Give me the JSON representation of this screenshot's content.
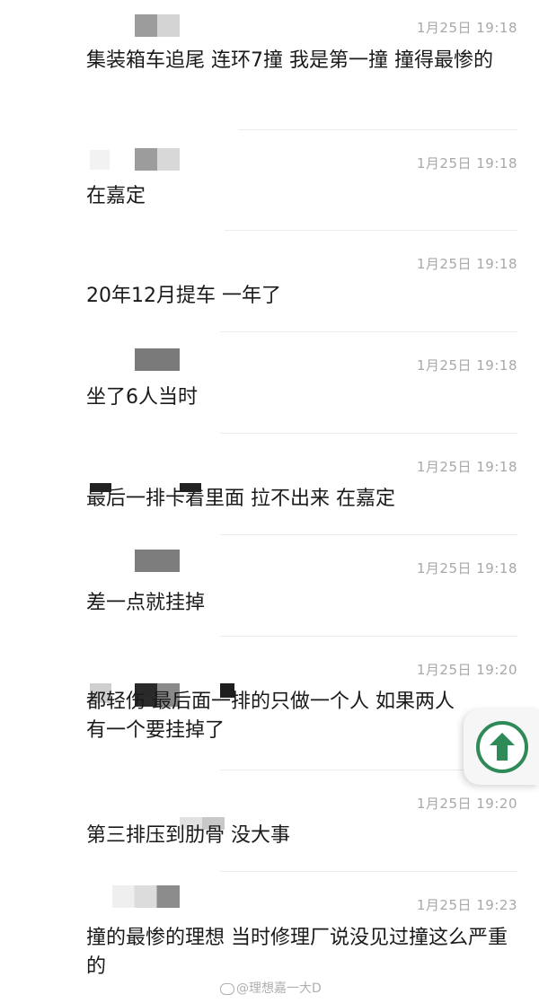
{
  "comments": [
    {
      "time": "1月25日 19:18",
      "text": "集装箱车追尾 连环7撞 我是第一撞 撞得最惨的"
    },
    {
      "time": "1月25日 19:18",
      "text": "在嘉定"
    },
    {
      "time": "1月25日 19:18",
      "text": "20年12月提车 一年了"
    },
    {
      "time": "1月25日 19:18",
      "text": "坐了6人当时"
    },
    {
      "time": "1月25日 19:18",
      "text": "最后一排卡着里面 拉不出来 在嘉定"
    },
    {
      "time": "1月25日 19:18",
      "text": "差一点就挂掉"
    },
    {
      "time": "1月25日 19:20",
      "text": "都轻伤 最后面一排的只做一个人 如果两人有一个要挂掉了"
    },
    {
      "time": "1月25日 19:20",
      "text": "第三排压到肋骨 没大事"
    },
    {
      "time": "1月25日 19:23",
      "text": "撞的最惨的理想 当时修理厂说没见过撞这么严重的"
    }
  ],
  "watermark": "@理想嘉一大D",
  "icons": {
    "scroll_top": "arrow-up-circle-icon",
    "weibo": "weibo-logo-icon"
  },
  "colors": {
    "accent": "#2e8b57",
    "time": "#a8a8a8",
    "text": "#1a1a1a"
  }
}
